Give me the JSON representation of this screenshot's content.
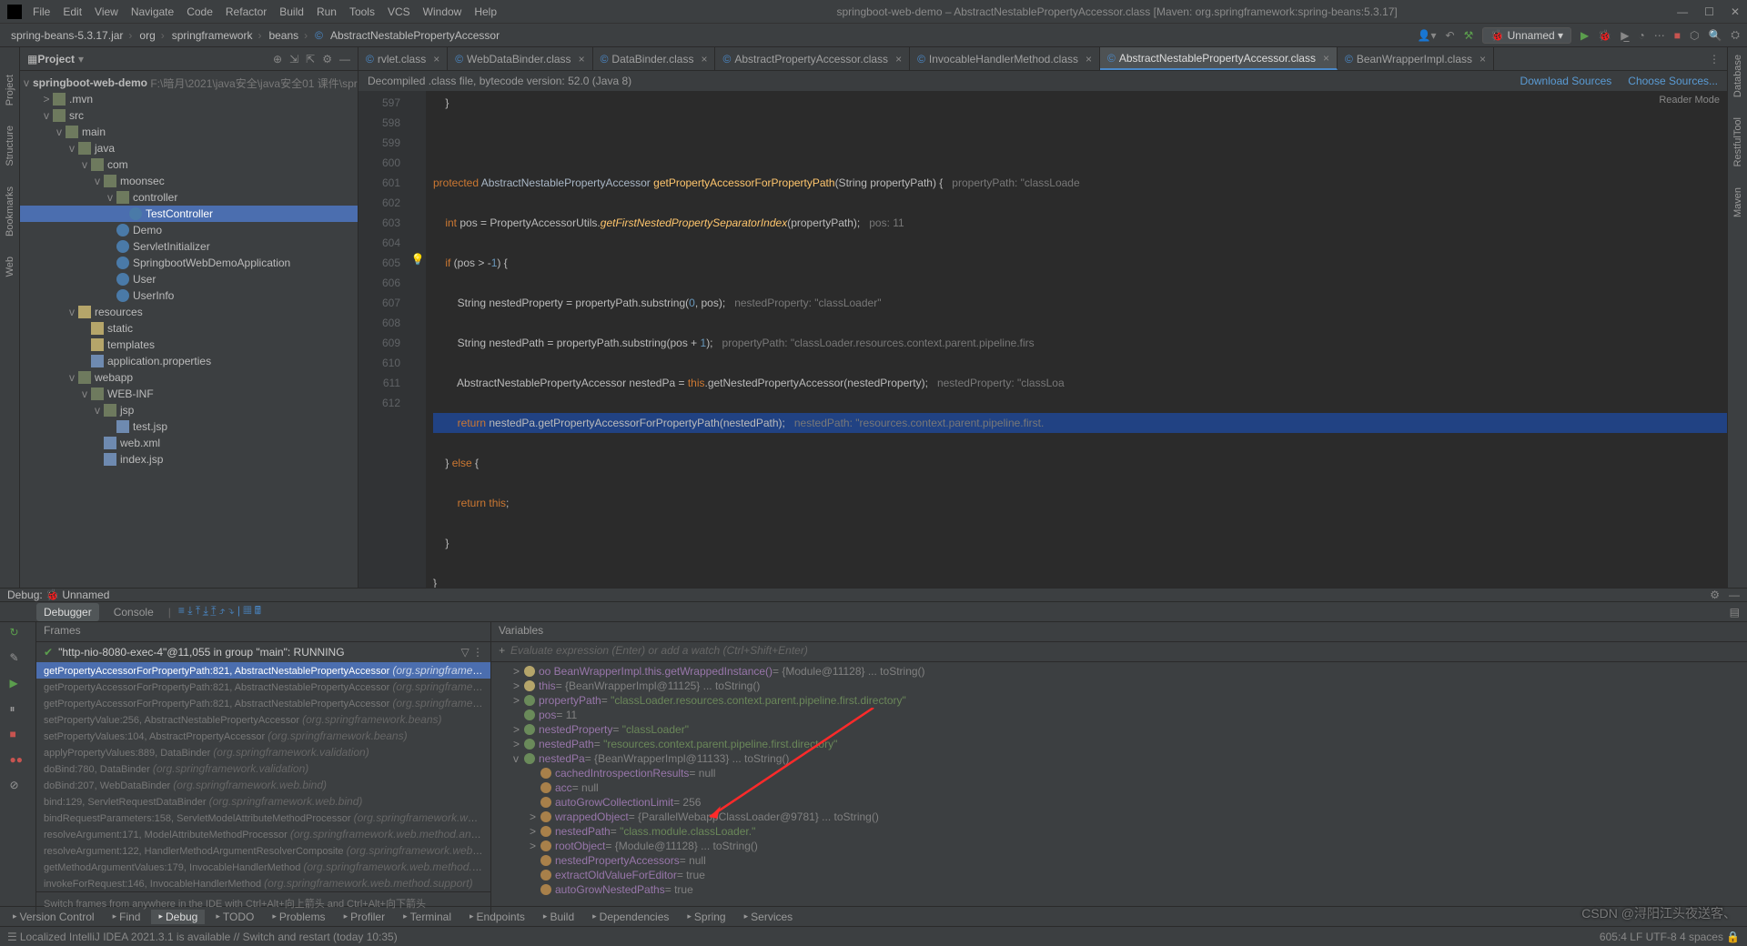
{
  "title": "springboot-web-demo – AbstractNestablePropertyAccessor.class [Maven: org.springframework:spring-beans:5.3.17]",
  "menu": [
    "File",
    "Edit",
    "View",
    "Navigate",
    "Code",
    "Refactor",
    "Build",
    "Run",
    "Tools",
    "VCS",
    "Window",
    "Help"
  ],
  "breadcrumb": [
    "spring-beans-5.3.17.jar",
    "org",
    "springframework",
    "beans",
    "AbstractNestablePropertyAccessor"
  ],
  "run_config": "Unnamed",
  "project_label": "Project",
  "reader_mode": "Reader Mode",
  "tree": {
    "root": "springboot-web-demo",
    "root_hint": "F:\\暗月\\2021\\java安全\\java安全01 课件\\springboo",
    "items": [
      {
        "d": 1,
        "a": ">",
        "i": "fld",
        "t": ".mvn"
      },
      {
        "d": 1,
        "a": "v",
        "i": "fld",
        "t": "src"
      },
      {
        "d": 2,
        "a": "v",
        "i": "fld",
        "t": "main"
      },
      {
        "d": 3,
        "a": "v",
        "i": "fld",
        "t": "java"
      },
      {
        "d": 4,
        "a": "v",
        "i": "fld",
        "t": "com"
      },
      {
        "d": 5,
        "a": "v",
        "i": "fld",
        "t": "moonsec"
      },
      {
        "d": 6,
        "a": "v",
        "i": "fld",
        "t": "controller"
      },
      {
        "d": 7,
        "a": "",
        "i": "cls",
        "t": "TestController",
        "sel": true
      },
      {
        "d": 6,
        "a": "",
        "i": "cls",
        "t": "Demo"
      },
      {
        "d": 6,
        "a": "",
        "i": "cls",
        "t": "ServletInitializer"
      },
      {
        "d": 6,
        "a": "",
        "i": "cls",
        "t": "SpringbootWebDemoApplication"
      },
      {
        "d": 6,
        "a": "",
        "i": "cls",
        "t": "User"
      },
      {
        "d": 6,
        "a": "",
        "i": "cls",
        "t": "UserInfo"
      },
      {
        "d": 3,
        "a": "v",
        "i": "fld2",
        "t": "resources"
      },
      {
        "d": 4,
        "a": "",
        "i": "fld2",
        "t": "static"
      },
      {
        "d": 4,
        "a": "",
        "i": "fld2",
        "t": "templates"
      },
      {
        "d": 4,
        "a": "",
        "i": "fil",
        "t": "application.properties"
      },
      {
        "d": 3,
        "a": "v",
        "i": "fld",
        "t": "webapp"
      },
      {
        "d": 4,
        "a": "v",
        "i": "fld",
        "t": "WEB-INF"
      },
      {
        "d": 5,
        "a": "v",
        "i": "fld",
        "t": "jsp"
      },
      {
        "d": 6,
        "a": "",
        "i": "fil",
        "t": "test.jsp"
      },
      {
        "d": 5,
        "a": "",
        "i": "fil",
        "t": "web.xml"
      },
      {
        "d": 5,
        "a": "",
        "i": "fil",
        "t": "index.jsp"
      }
    ]
  },
  "tabs": [
    {
      "t": "rvlet.class"
    },
    {
      "t": "WebDataBinder.class"
    },
    {
      "t": "DataBinder.class"
    },
    {
      "t": "AbstractPropertyAccessor.class"
    },
    {
      "t": "InvocableHandlerMethod.class"
    },
    {
      "t": "AbstractNestablePropertyAccessor.class",
      "act": true
    },
    {
      "t": "BeanWrapperImpl.class"
    }
  ],
  "banner": {
    "msg": "Decompiled .class file, bytecode version: 52.0 (Java 8)",
    "dl": "Download Sources",
    "ch": "Choose Sources..."
  },
  "code_lines": [
    "597",
    "598",
    "599",
    "600",
    "601",
    "602",
    "603",
    "604",
    "605",
    "606",
    "607",
    "608",
    "609",
    "610",
    "611",
    "612"
  ],
  "debug": {
    "label": "Debug:",
    "session": "Unnamed",
    "tab_dbg": "Debugger",
    "tab_con": "Console",
    "frames_label": "Frames",
    "vars_label": "Variables",
    "thread": "\"http-nio-8080-exec-4\"@11,055 in group \"main\": RUNNING",
    "frames": [
      {
        "m": "getPropertyAccessorForPropertyPath:821, AbstractNestablePropertyAccessor",
        "p": "(org.springframework.beans)",
        "sel": true
      },
      {
        "m": "getPropertyAccessorForPropertyPath:821, AbstractNestablePropertyAccessor",
        "p": "(org.springframework.beans)"
      },
      {
        "m": "getPropertyAccessorForPropertyPath:821, AbstractNestablePropertyAccessor",
        "p": "(org.springframework.beans"
      },
      {
        "m": "setPropertyValue:256, AbstractNestablePropertyAccessor",
        "p": "(org.springframework.beans)"
      },
      {
        "m": "setPropertyValues:104, AbstractPropertyAccessor",
        "p": "(org.springframework.beans)"
      },
      {
        "m": "applyPropertyValues:889, DataBinder",
        "p": "(org.springframework.validation)"
      },
      {
        "m": "doBind:780, DataBinder",
        "p": "(org.springframework.validation)"
      },
      {
        "m": "doBind:207, WebDataBinder",
        "p": "(org.springframework.web.bind)"
      },
      {
        "m": "bind:129, ServletRequestDataBinder",
        "p": "(org.springframework.web.bind)"
      },
      {
        "m": "bindRequestParameters:158, ServletModelAttributeMethodProcessor",
        "p": "(org.springframework.web.servlet.mvc"
      },
      {
        "m": "resolveArgument:171, ModelAttributeMethodProcessor",
        "p": "(org.springframework.web.method.annotation)"
      },
      {
        "m": "resolveArgument:122, HandlerMethodArgumentResolverComposite",
        "p": "(org.springframework.web.method.sup"
      },
      {
        "m": "getMethodArgumentValues:179, InvocableHandlerMethod",
        "p": "(org.springframework.web.method.support)"
      },
      {
        "m": "invokeForRequest:146, InvocableHandlerMethod",
        "p": "(org.springframework.web.method.support)"
      }
    ],
    "frames_hint": "Switch frames from anywhere in the IDE with Ctrl+Alt+向上箭头 and Ctrl+Alt+向下箭头",
    "eval_hint": "Evaluate expression (Enter) or add a watch (Ctrl+Shift+Enter)",
    "vars": [
      {
        "d": 0,
        "a": ">",
        "i": "o",
        "n": "oo BeanWrapperImpl.this.getWrappedInstance()",
        "v": " = {Module@11128} ... toString()"
      },
      {
        "d": 0,
        "a": ">",
        "i": "o",
        "n": "this",
        "v": " = {BeanWrapperImpl@11125} ... toString()"
      },
      {
        "d": 0,
        "a": ">",
        "i": "p",
        "n": "propertyPath",
        "v": " = \"classLoader.resources.context.parent.pipeline.first.directory\""
      },
      {
        "d": 0,
        "a": "",
        "i": "p",
        "n": "pos",
        "v": " = 11"
      },
      {
        "d": 0,
        "a": ">",
        "i": "p",
        "n": "nestedProperty",
        "v": " = \"classLoader\""
      },
      {
        "d": 0,
        "a": ">",
        "i": "p",
        "n": "nestedPath",
        "v": " = \"resources.context.parent.pipeline.first.directory\""
      },
      {
        "d": 0,
        "a": "v",
        "i": "p",
        "n": "nestedPa",
        "v": " = {BeanWrapperImpl@11133} ... toString()"
      },
      {
        "d": 1,
        "a": "",
        "i": "f",
        "n": "cachedIntrospectionResults",
        "v": " = null"
      },
      {
        "d": 1,
        "a": "",
        "i": "f",
        "n": "acc",
        "v": " = null"
      },
      {
        "d": 1,
        "a": "",
        "i": "f",
        "n": "autoGrowCollectionLimit",
        "v": " = 256"
      },
      {
        "d": 1,
        "a": ">",
        "i": "f",
        "n": "wrappedObject",
        "v": " = {ParallelWebappClassLoader@9781} ... toString()"
      },
      {
        "d": 1,
        "a": ">",
        "i": "f",
        "n": "nestedPath",
        "v": " = \"class.module.classLoader.\""
      },
      {
        "d": 1,
        "a": ">",
        "i": "f",
        "n": "rootObject",
        "v": " = {Module@11128} ... toString()"
      },
      {
        "d": 1,
        "a": "",
        "i": "f",
        "n": "nestedPropertyAccessors",
        "v": " = null"
      },
      {
        "d": 1,
        "a": "",
        "i": "f",
        "n": "extractOldValueForEditor",
        "v": " = true"
      },
      {
        "d": 1,
        "a": "",
        "i": "f",
        "n": "autoGrowNestedPaths",
        "v": " = true"
      }
    ]
  },
  "toolwindows": [
    {
      "t": "Version Control"
    },
    {
      "t": "Find"
    },
    {
      "t": "Debug",
      "act": true
    },
    {
      "t": "TODO"
    },
    {
      "t": "Problems"
    },
    {
      "t": "Profiler"
    },
    {
      "t": "Terminal"
    },
    {
      "t": "Endpoints"
    },
    {
      "t": "Build"
    },
    {
      "t": "Dependencies"
    },
    {
      "t": "Spring"
    },
    {
      "t": "Services"
    }
  ],
  "status_left": "Localized IntelliJ IDEA 2021.3.1 is available // Switch and restart (today 10:35)",
  "status_right": "605:4   LF   UTF-8   4 spaces",
  "watermark": "CSDN @浔阳江头夜送客、"
}
